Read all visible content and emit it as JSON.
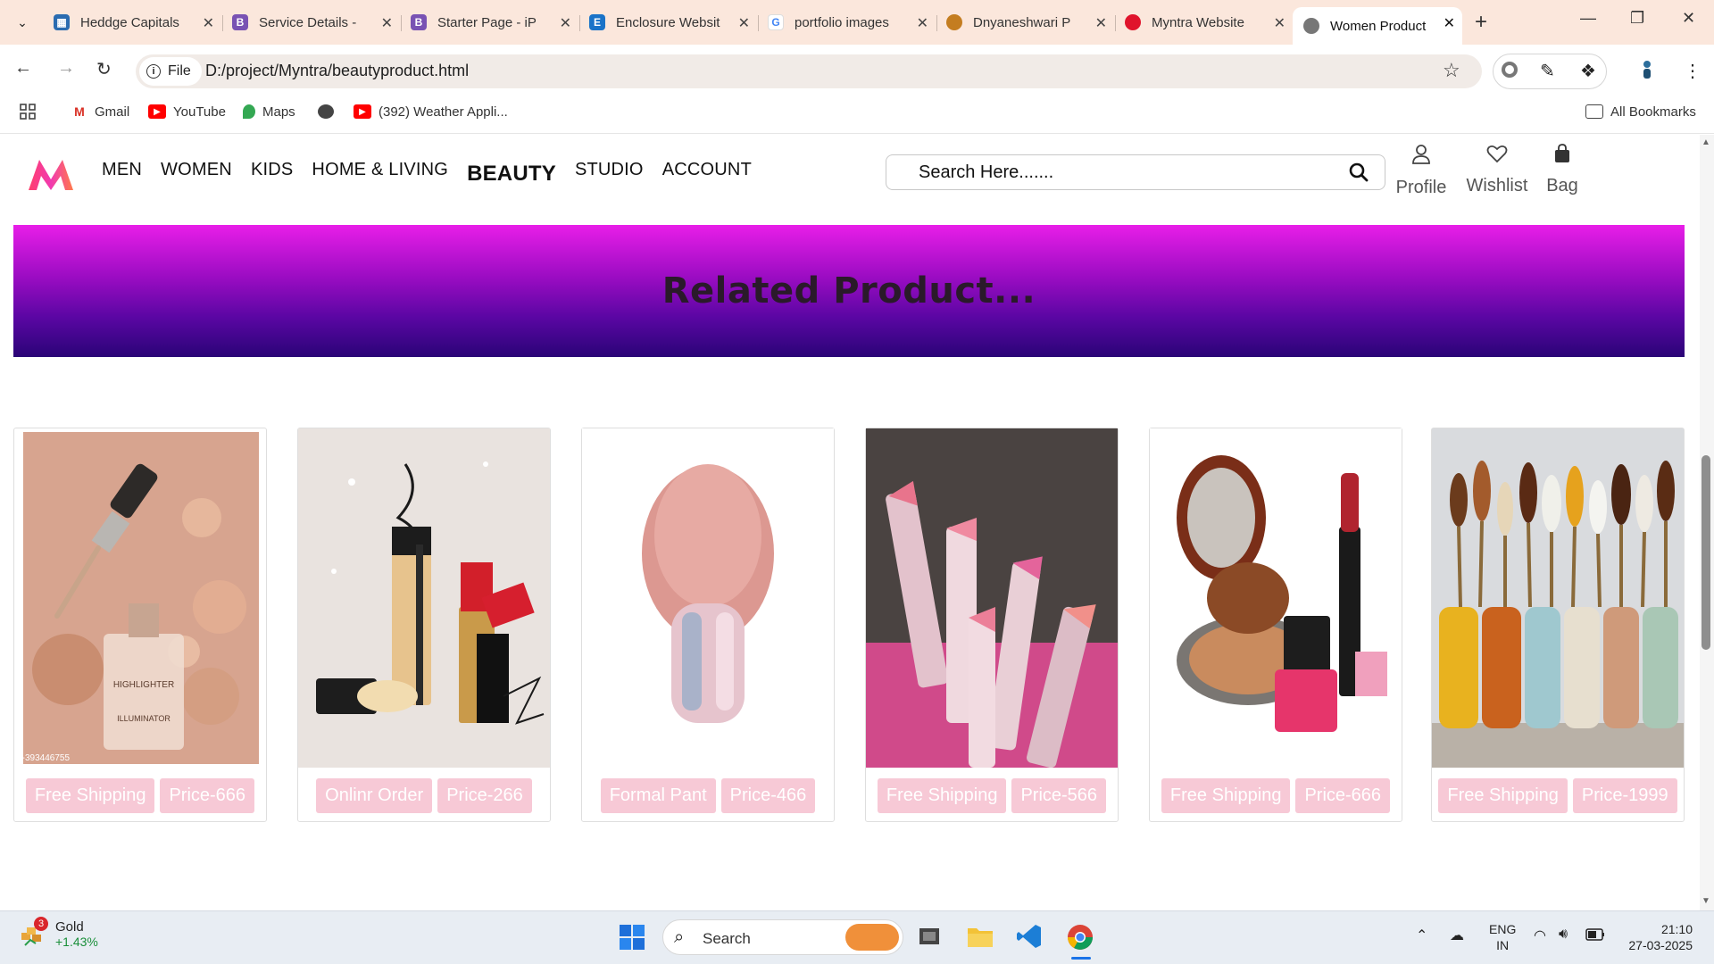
{
  "browser": {
    "tabs": [
      {
        "title": "Heddge Capitals",
        "icon": "film-icon",
        "color": "#2b6cb0"
      },
      {
        "title": "Service Details -",
        "icon": "bootstrap-icon",
        "color": "#7952b3"
      },
      {
        "title": "Starter Page - iP",
        "icon": "bootstrap-icon",
        "color": "#7952b3"
      },
      {
        "title": "Enclosure Websit",
        "icon": "enclosure-icon",
        "color": "#1a73c8"
      },
      {
        "title": "portfolio images",
        "icon": "google-icon",
        "color": "#4285f4"
      },
      {
        "title": "Dnyaneshwari P",
        "icon": "globe-photo-icon",
        "color": "#c47d20"
      },
      {
        "title": "Myntra Website",
        "icon": "red-dot-icon",
        "color": "#e0142c"
      },
      {
        "title": "Women Product",
        "icon": "globe-icon",
        "color": "#555555"
      }
    ],
    "address": {
      "chip": "File",
      "url": "D:/project/Myntra/beautyproduct.html"
    },
    "bookmarks": [
      {
        "label": "Gmail"
      },
      {
        "label": "YouTube"
      },
      {
        "label": "Maps"
      },
      {
        "label": ""
      },
      {
        "label": "(392) Weather Appli..."
      }
    ],
    "all_bookmarks": "All Bookmarks"
  },
  "site": {
    "nav": [
      "MEN",
      "WOMEN",
      "KIDS",
      "HOME & LIVING",
      "BEAUTY",
      "STUDIO",
      "ACCOUNT"
    ],
    "search_placeholder": "Search Here.......",
    "header_icons": [
      {
        "label": "Profile",
        "icon": "profile-icon"
      },
      {
        "label": "Wishlist",
        "icon": "heart-icon"
      },
      {
        "label": "Bag",
        "icon": "bag-icon"
      }
    ],
    "banner_title": "Related Product...",
    "products": [
      {
        "tag1": "Free Shipping",
        "tag2": "Price-666",
        "image": "highlighter-bottle-image",
        "watermark": "S-393446755"
      },
      {
        "tag1": "Onlinr Order",
        "tag2": "Price-266",
        "image": "makeup-kit-image"
      },
      {
        "tag1": "Formal Pant",
        "tag2": "Price-466",
        "image": "pink-brush-image"
      },
      {
        "tag1": "Free Shipping",
        "tag2": "Price-566",
        "image": "lipsticks-image"
      },
      {
        "tag1": "Free Shipping",
        "tag2": "Price-666",
        "image": "compact-powder-image"
      },
      {
        "tag1": "Free Shipping",
        "tag2": "Price-1999",
        "image": "brushes-vases-image"
      }
    ],
    "tag_color": "#f7c9d6"
  },
  "taskbar": {
    "weather_badge": "3",
    "weather_title": "Gold",
    "weather_change": "+1.43%",
    "search_label": "Search",
    "lang_line1": "ENG",
    "lang_line2": "IN",
    "time": "21:10",
    "date": "27-03-2025"
  }
}
